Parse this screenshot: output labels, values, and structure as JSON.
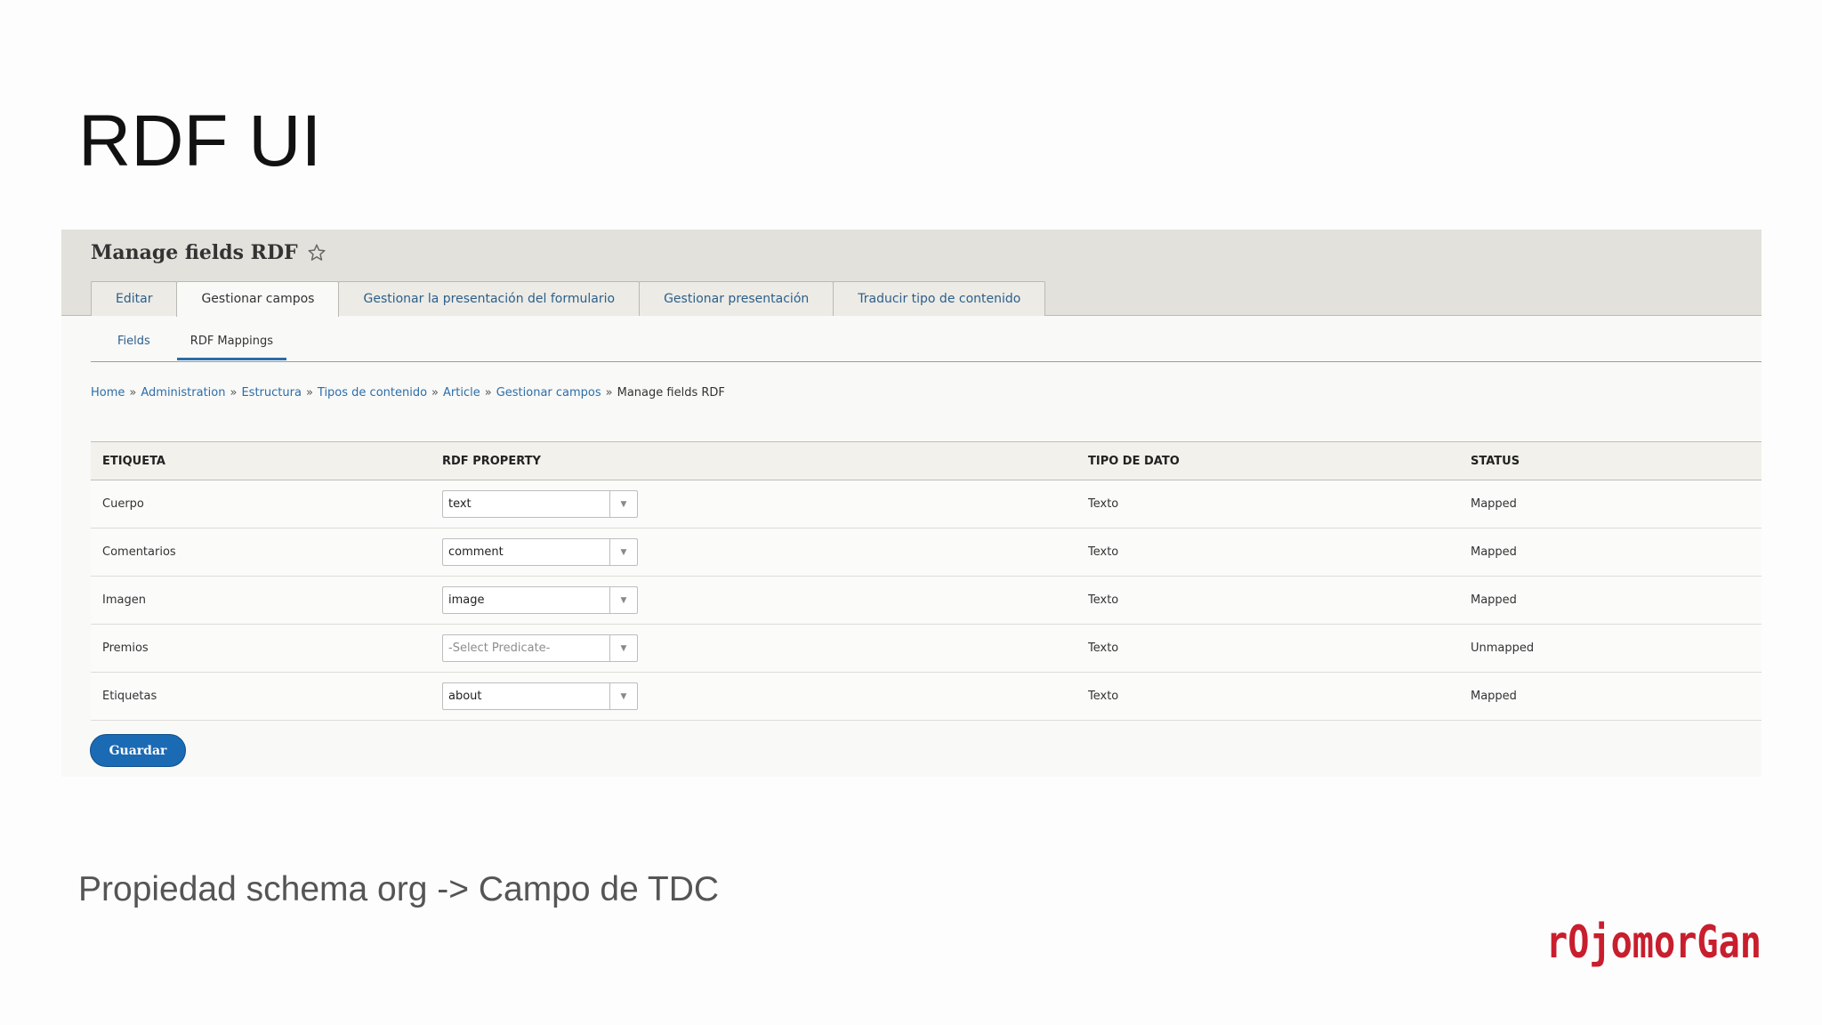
{
  "slide": {
    "title": "RDF UI",
    "caption": "Propiedad schema org -> Campo de TDC",
    "logo_text": "rOjomorGan",
    "logo_color": "#c81e2d"
  },
  "page": {
    "title": "Manage fields RDF",
    "star_icon": "star-outline-icon"
  },
  "tabs": [
    {
      "label": "Editar",
      "active": false
    },
    {
      "label": "Gestionar campos",
      "active": true
    },
    {
      "label": "Gestionar la presentación del formulario",
      "active": false
    },
    {
      "label": "Gestionar presentación",
      "active": false
    },
    {
      "label": "Traducir tipo de contenido",
      "active": false
    }
  ],
  "subtabs": [
    {
      "label": "Fields",
      "active": false
    },
    {
      "label": "RDF Mappings",
      "active": true
    }
  ],
  "breadcrumb": {
    "links": [
      "Home",
      "Administration",
      "Estructura",
      "Tipos de contenido",
      "Article",
      "Gestionar campos"
    ],
    "current": "Manage fields RDF",
    "separator": "»"
  },
  "table": {
    "headers": [
      "ETIQUETA",
      "RDF PROPERTY",
      "TIPO DE DATO",
      "STATUS"
    ],
    "rows": [
      {
        "label": "Cuerpo",
        "property": "text",
        "placeholder": false,
        "datatype": "Texto",
        "status": "Mapped"
      },
      {
        "label": "Comentarios",
        "property": "comment",
        "placeholder": false,
        "datatype": "Texto",
        "status": "Mapped"
      },
      {
        "label": "Imagen",
        "property": "image",
        "placeholder": false,
        "datatype": "Texto",
        "status": "Mapped"
      },
      {
        "label": "Premios",
        "property": "-Select Predicate-",
        "placeholder": true,
        "datatype": "Texto",
        "status": "Unmapped"
      },
      {
        "label": "Etiquetas",
        "property": "about",
        "placeholder": false,
        "datatype": "Texto",
        "status": "Mapped"
      }
    ]
  },
  "actions": {
    "save_label": "Guardar"
  },
  "colors": {
    "link": "#2c6ea8",
    "primary_button": "#1b6ab4",
    "header_bg": "#e2e1dc"
  }
}
